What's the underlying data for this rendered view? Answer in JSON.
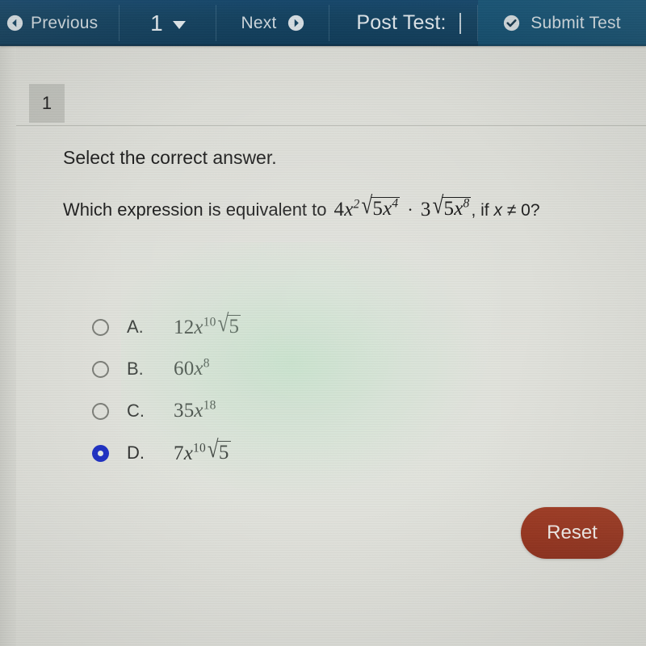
{
  "toolbar": {
    "previous_label": "Previous",
    "previous_icon": "arrow-left-circle-icon",
    "question_number": "1",
    "question_number_caret_icon": "chevron-down-icon",
    "next_label": "Next",
    "next_icon": "arrow-right-circle-icon",
    "title": "Post Test:",
    "submit_label": "Submit Test",
    "submit_icon": "check-circle-icon",
    "background_color": "#12415f",
    "text_color": "#cdd7dd"
  },
  "content": {
    "question_tab_number": "1",
    "prompt": "Select the correct answer.",
    "question_lead": "Which expression is equivalent to",
    "expression": {
      "coefficient1": "4",
      "var1": "x",
      "exp1": "2",
      "radicand1_coeff": "5",
      "radicand1_var": "x",
      "radicand1_exp": "4",
      "operator": "·",
      "coefficient2": "3",
      "radicand2_coeff": "5",
      "radicand2_var": "x",
      "radicand2_exp": "8",
      "plain": "4x^2√(5x^4) · 3√(5x^8)"
    },
    "condition_prefix": ", if",
    "condition_var": "x",
    "condition_rest": "≠ 0?",
    "options": [
      {
        "letter": "A.",
        "selected": false,
        "coefficient": "12",
        "var": "x",
        "exponent": "10",
        "radicand": "5",
        "has_radical": true,
        "plain": "12x^10√5"
      },
      {
        "letter": "B.",
        "selected": false,
        "coefficient": "60",
        "var": "x",
        "exponent": "8",
        "radicand": "",
        "has_radical": false,
        "plain": "60x^8"
      },
      {
        "letter": "C.",
        "selected": false,
        "coefficient": "35",
        "var": "x",
        "exponent": "18",
        "radicand": "",
        "has_radical": false,
        "plain": "35x^18"
      },
      {
        "letter": "D.",
        "selected": true,
        "coefficient": "7",
        "var": "x",
        "exponent": "10",
        "radicand": "5",
        "has_radical": true,
        "plain": "7x^10√5"
      }
    ],
    "reset_label": "Reset",
    "reset_color": "#96331d",
    "selected_radio_color": "#1d2fc4"
  }
}
